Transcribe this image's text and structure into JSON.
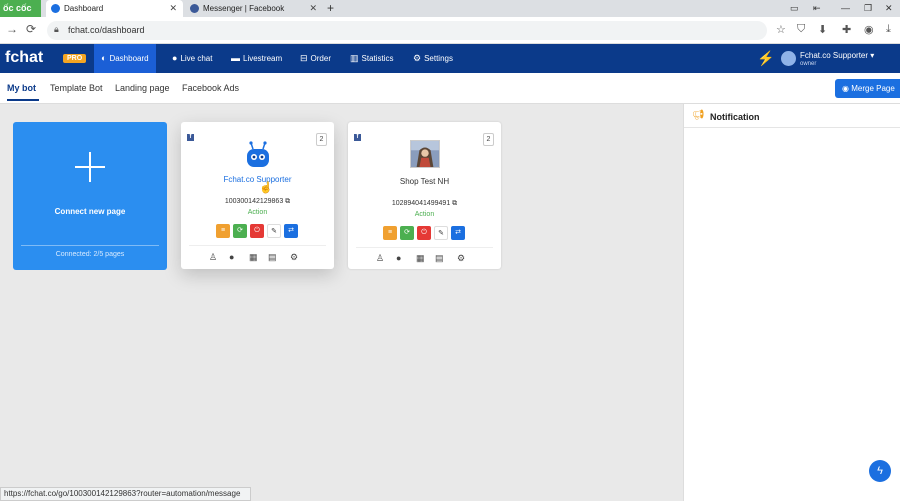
{
  "browser": {
    "brand": "ốc cốc",
    "tabs": [
      {
        "title": "Dashboard",
        "close": "✕"
      },
      {
        "title": "Messenger | Facebook",
        "close": "✕"
      }
    ],
    "new_tab": "+",
    "url": "fchat.co/dashboard",
    "status_url": "https://fchat.co/go/100300142129863?router=automation/message"
  },
  "app": {
    "logo": "fchat",
    "badge": "PRO",
    "nav": [
      {
        "label": "Dashboard",
        "icon": "dashboard-icon"
      },
      {
        "label": "Live chat",
        "icon": "chat-icon"
      },
      {
        "label": "Livestream",
        "icon": "video-icon"
      },
      {
        "label": "Order",
        "icon": "cart-icon"
      },
      {
        "label": "Statistics",
        "icon": "bar-chart-icon"
      },
      {
        "label": "Settings",
        "icon": "gear-icon"
      }
    ],
    "user": {
      "name": "Fchat.co Supporter",
      "role": "owner"
    }
  },
  "subtabs": [
    "My bot",
    "Template Bot",
    "Landing page",
    "Facebook Ads"
  ],
  "merge_button": "Merge Page",
  "connect_card": {
    "label": "Connect new page",
    "connected": "Connected: 2/5 pages"
  },
  "pages": [
    {
      "name": "Fchat.co Supporter",
      "id": "100300142129863",
      "action": "Action",
      "count": "2"
    },
    {
      "name": "Shop Test NH",
      "id": "102894041499491",
      "action": "Action",
      "count": "2"
    }
  ],
  "notification": {
    "title": "Notification"
  },
  "colors": {
    "primary": "#0b3a8a",
    "accent": "#1b6fe0",
    "connect": "#2b8ef0",
    "action": "#4caf50"
  }
}
